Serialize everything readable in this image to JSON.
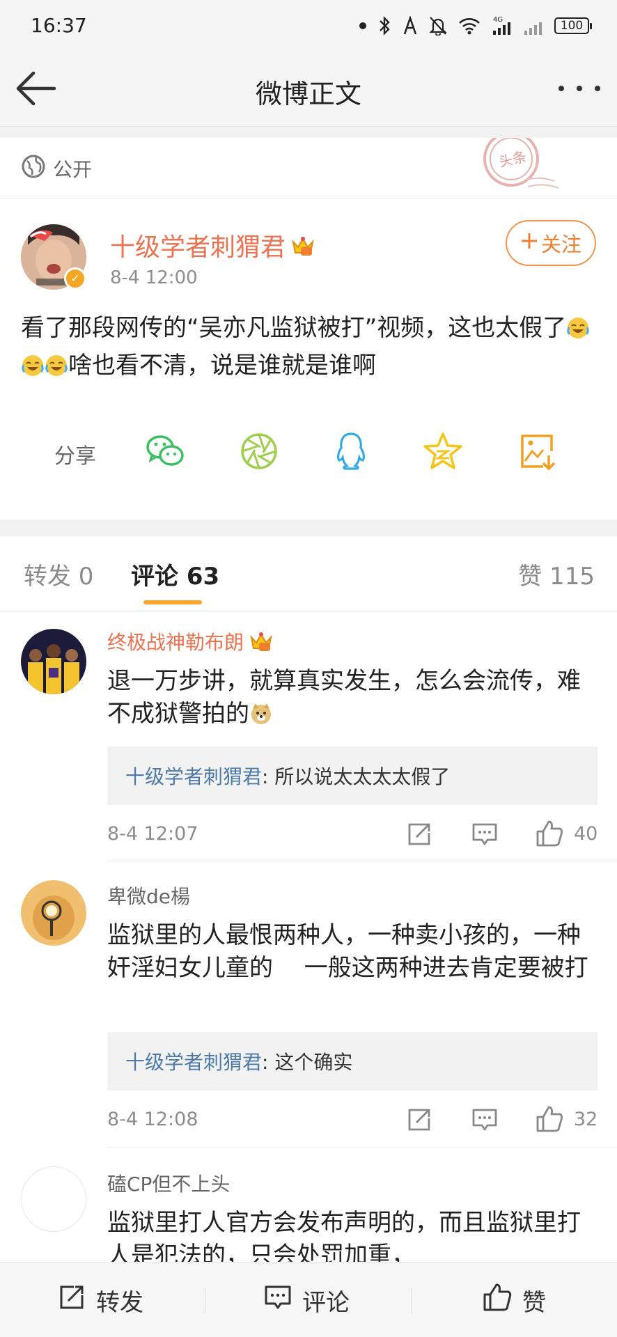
{
  "status_bar": {
    "time": "16:37",
    "signal_label": "4G",
    "battery": "100"
  },
  "nav": {
    "title": "微博正文"
  },
  "post": {
    "visibility": "公开",
    "stamp_text": "头条",
    "author": "十级学者刺猬君",
    "time": "8-4 12:00",
    "follow_label": "关注",
    "text_part1": "看了那段网传的“吴亦凡监狱被打”视频，这也太假了",
    "text_part2": "啥也看不清，说是谁就是谁啊",
    "share_label": "分享",
    "share_icons": [
      "wechat-icon",
      "moments-icon",
      "qq-icon",
      "qzone-icon",
      "save-image-icon"
    ]
  },
  "tabs": {
    "repost": "转发 0",
    "comments": "评论 63",
    "likes": "赞 115"
  },
  "comments": [
    {
      "name": "终极战神勒布朗",
      "text": "退一万步讲，就算真实发生，怎么会流传，难不成狱警拍的",
      "reply_author": "十级学者刺猬君",
      "reply_text": ": 所以说太太太太假了",
      "time": "8-4 12:07",
      "likes": "40"
    },
    {
      "name": "卑微de楊",
      "text": "监狱里的人最恨两种人，一种卖小孩的，一种奸淫妇女儿童的　 一般这两种进去肯定要被打",
      "reply_author": "十级学者刺猬君",
      "reply_text": ": 这个确实",
      "time": "8-4 12:08",
      "likes": "32"
    },
    {
      "name": "磕CP但不上头",
      "text": "监狱里打人官方会发布声明的，而且监狱里打人是犯法的，只会处罚加重，"
    }
  ],
  "bottom_bar": {
    "repost": "转发",
    "comment": "评论",
    "like": "赞"
  },
  "colors": {
    "accent_orange": "#eb7350",
    "tab_underline": "#f7a531",
    "reply_name_blue": "#4d7ba8",
    "wechat_green": "#3cbf60",
    "moments_green": "#9fce4c",
    "qq_blue": "#36a9e1",
    "qzone_yellow": "#f5c518"
  }
}
